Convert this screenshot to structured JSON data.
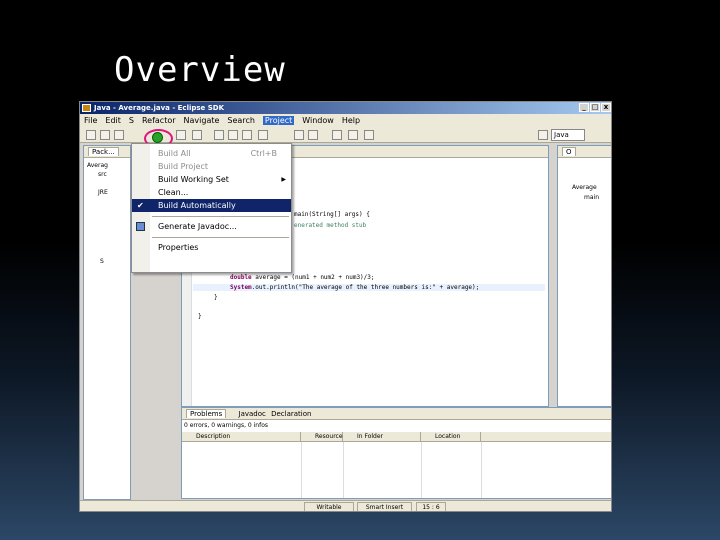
{
  "slide": {
    "title": "Overview"
  },
  "window": {
    "title": "Java - Average.java - Eclipse SDK",
    "controls": [
      "_",
      "□",
      "x"
    ]
  },
  "menubar": {
    "items": [
      "File",
      "Edit",
      "S",
      "Refactor",
      "Navigate",
      "Search",
      "Project",
      "Window",
      "Help"
    ]
  },
  "toolbar": {
    "perspective": "Java"
  },
  "explorer": {
    "tab": "Pack...",
    "tree": [
      "Averag",
      "src",
      "JRE",
      "S"
    ]
  },
  "editor": {
    "lines": [
      {
        "pre": "",
        "kw": "",
        "rest": "main(String[] args) {"
      },
      {
        "pre": "",
        "kw": "",
        "rest": "enerated method stub",
        "cls": "cm"
      },
      {
        "pre": "",
        "kw": "double",
        "rest": " average = (num1 + num2 + num3)/3;"
      },
      {
        "pre": "",
        "kw": "System",
        "rest": ".out.println(\"The average of the three numbers is:\" + average);"
      },
      {
        "pre": "",
        "kw": "",
        "rest": "}"
      },
      {
        "pre": "",
        "kw": "",
        "rest": "}"
      }
    ]
  },
  "outline": {
    "tab": "O",
    "items": [
      "Average",
      "main"
    ]
  },
  "problems": {
    "tabs": [
      "Problems",
      "Javadoc",
      "Declaration"
    ],
    "summary": "0 errors, 0 warnings, 0 infos",
    "columns": [
      "Description",
      "Resource",
      "In Folder",
      "Location"
    ]
  },
  "status": {
    "writable": "Writable",
    "insert": "Smart Insert",
    "position": "15 : 6"
  },
  "project_menu": {
    "items": [
      {
        "label": "Build All",
        "shortcut": "Ctrl+B",
        "state": "disabled"
      },
      {
        "label": "Build Project",
        "state": "disabled"
      },
      {
        "label": "Build Working Set",
        "submenu": true
      },
      {
        "label": "Clean..."
      },
      {
        "label": "Build Automatically",
        "checked": true,
        "state": "selected"
      },
      {
        "label": "Generate Javadoc..."
      },
      {
        "label": "Properties"
      }
    ]
  }
}
